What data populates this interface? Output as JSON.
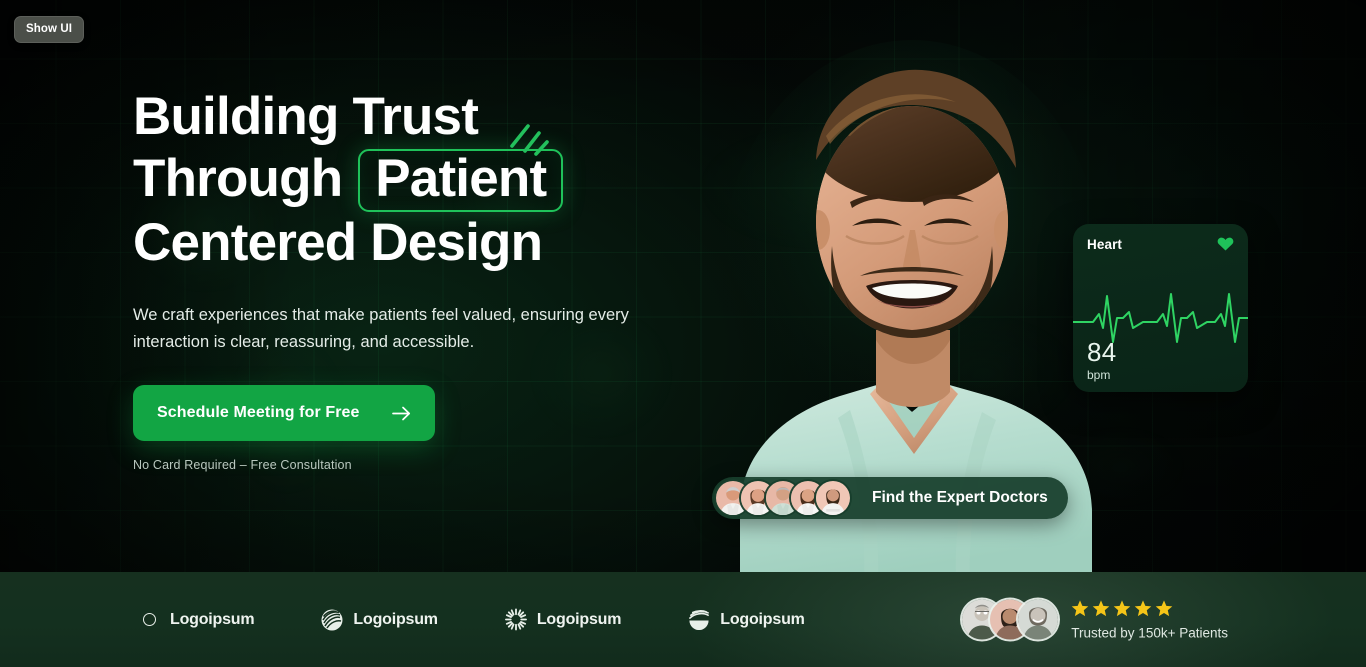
{
  "overlay": {
    "show_ui_label": "Show UI"
  },
  "hero": {
    "heading_line1": "Building Trust",
    "heading_line2_before": "Through",
    "heading_highlight": "Patient",
    "heading_line3": "Centered Design",
    "subtitle": "We craft experiences that make patients feel valued, ensuring every interaction is clear, reassuring, and accessible.",
    "cta_label": "Schedule Meeting for Free",
    "cta_arrow_icon": "arrow-right-icon",
    "fine_print": "No Card Required – Free Consultation",
    "sparkle_icon": "sparkle-lines-icon"
  },
  "heart_card": {
    "title": "Heart",
    "icon": "heart-icon",
    "value": "84",
    "unit": "bpm",
    "waveform_icon": "ecg-line-icon"
  },
  "doctors_pill": {
    "label": "Find the Expert Doctors",
    "avatar_count": 5,
    "avatars": [
      {
        "name": "doctor-avatar-1"
      },
      {
        "name": "doctor-avatar-2"
      },
      {
        "name": "doctor-avatar-3"
      },
      {
        "name": "doctor-avatar-4"
      },
      {
        "name": "doctor-avatar-5"
      }
    ]
  },
  "footer": {
    "logos": [
      {
        "name": "Logoipsum",
        "mark": "crescent-icon"
      },
      {
        "name": "Logoipsum",
        "mark": "spiral-icon"
      },
      {
        "name": "Logoipsum",
        "mark": "starburst-icon"
      },
      {
        "name": "Logoipsum",
        "mark": "striped-bowl-icon"
      }
    ],
    "trust": {
      "text": "Trusted by 150k+ Patients",
      "rating": 5,
      "star_icon": "star-icon",
      "avatars": [
        {
          "name": "patient-avatar-1"
        },
        {
          "name": "patient-avatar-2"
        },
        {
          "name": "patient-avatar-3"
        }
      ]
    }
  },
  "colors": {
    "accent_green": "#12a544",
    "highlight_border": "#1fc25a",
    "footer_bg": "#16301f",
    "star_gold": "#f5c518",
    "page_bg": "#050a07"
  }
}
